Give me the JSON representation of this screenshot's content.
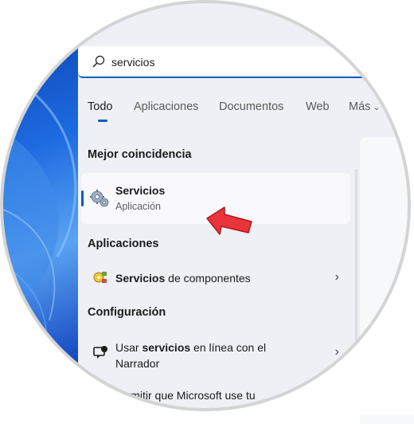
{
  "search": {
    "query": "servicios"
  },
  "tabs": [
    {
      "label": "Todo",
      "active": true
    },
    {
      "label": "Aplicaciones",
      "active": false
    },
    {
      "label": "Documentos",
      "active": false
    },
    {
      "label": "Web",
      "active": false
    },
    {
      "label": "Más",
      "active": false
    }
  ],
  "best_match": {
    "heading": "Mejor coincidencia",
    "title": "Servicios",
    "subtitle": "Aplicación",
    "icon": "gears-icon"
  },
  "apps": {
    "heading": "Aplicaciones",
    "items": [
      {
        "bold": "Servicios",
        "rest": " de componentes",
        "icon": "component-services-icon"
      }
    ]
  },
  "settings": {
    "heading": "Configuración",
    "items": [
      {
        "pre": "Usar ",
        "bold": "servicios",
        "post": " en línea con el",
        "line2": "Narrador",
        "icon": "narrator-icon"
      },
      {
        "text": "permitir que Microsoft use tu",
        "icon": ""
      }
    ]
  },
  "colors": {
    "accent": "#0b5cbd",
    "arrow": "#e8343a"
  }
}
